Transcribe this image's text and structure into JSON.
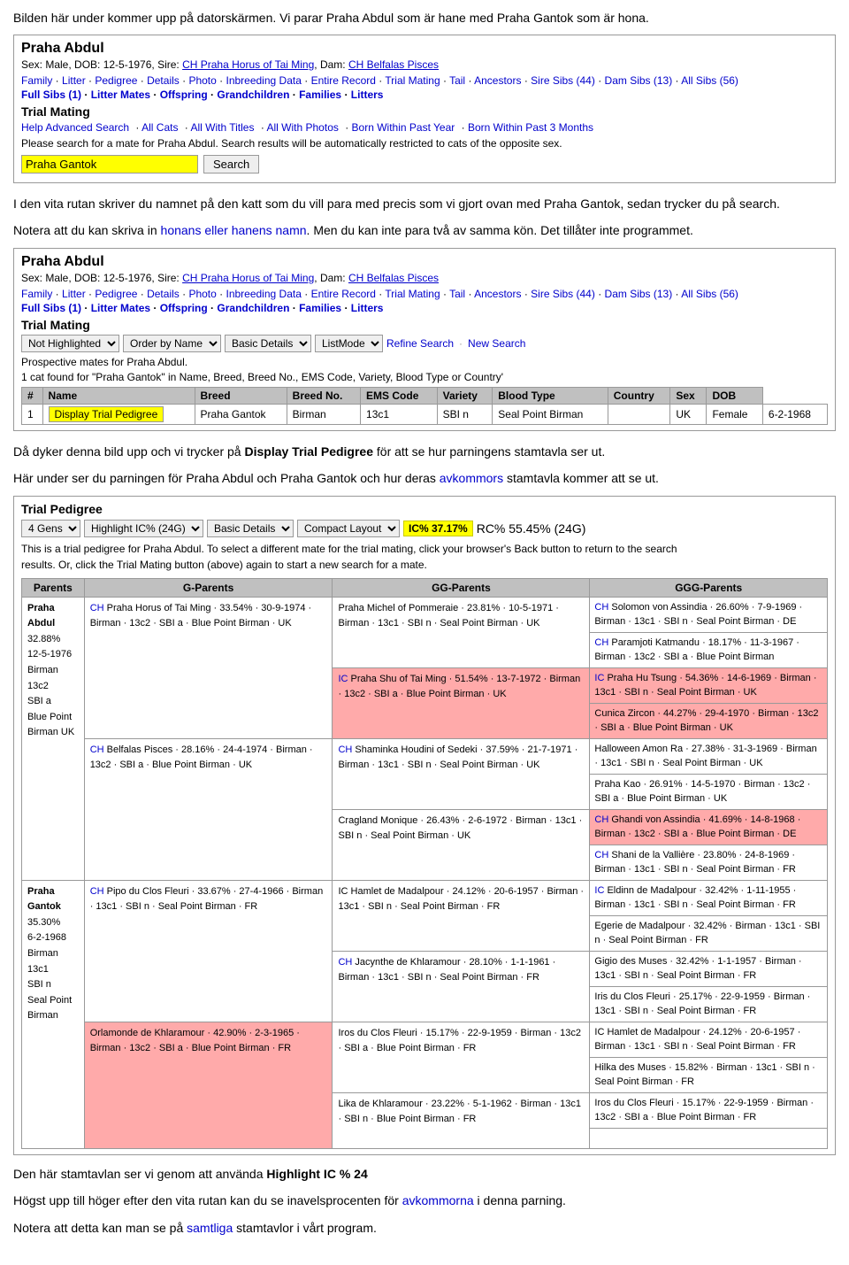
{
  "intro": {
    "heading": "Bilden här under kommer upp på datorskärmen. Vi parar Praha Abdul som är hane med Praha Gantok som är hona.",
    "cat_name": "Praha Abdul",
    "cat_info": "Sex: Male, DOB: 12-5-1976, Sire: CH Praha Horus of Tai Ming, Dam: CH Belfalas Pisces",
    "nav1": "Family · Litter · Pedigree · Details · Photo · Inbreeding Data · Entire Record · Trial Mating · Tail · Ancestors · Sire Sibs (44) · Dam Sibs (13) · All Sibs (56)",
    "nav2": "Full Sibs (1) · Litter Mates · Offspring · Grandchildren · Families · Litters",
    "section_title": "Trial Mating",
    "trial_links": "Help Advanced Search · All Cats · All With Titles · All With Photos · Born Within Past Year · Born Within Past 3 Months",
    "search_note": "Please search for a mate for Praha Abdul. Search results will be automatically restricted to cats of the opposite sex.",
    "search_placeholder": "Praha Gantok",
    "search_btn": "Search"
  },
  "body1": {
    "para1": "I den vita rutan skriver du namnet på den katt som du vill para med precis som vi gjort ovan med Praha Gantok, sedan trycker du på search.",
    "para2_prefix": "Notera att du kan skriva in ",
    "para2_link": "honans eller hanens namn",
    "para2_suffix": ". Men du kan inte para två av samma kön. Det tillåter inte programmet."
  },
  "pedigree2": {
    "cat_name": "Praha Abdul",
    "cat_info": "Sex: Male, DOB: 12-5-1976, Sire: CH Praha Horus of Tai Ming, Dam: CH Belfalas Pisces",
    "nav1": "Family · Litter · Pedigree · Details · Photo · Inbreeding Data · Entire Record · Trial Mating · Tail · Ancestors · Sire Sibs (44) · Dam Sibs (13) · All Sibs (56)",
    "nav2": "Full Sibs (1) · Litter Mates · Offspring · Grandchildren · Families · Litters",
    "section_title": "Trial Mating",
    "not_highlighted_label": "Not Highlighted",
    "order_label": "Order by Name",
    "basic_details_label": "Basic Details",
    "list_mode_label": "ListMode",
    "refine_search": "Refine Search",
    "new_search": "New Search",
    "prospect_text": "Prospective mates for Praha Abdul.",
    "found_text": "1 cat found for \"Praha Gantok\" in Name, Breed, Breed No., EMS Code, Variety, Blood Type or Country'",
    "table_headers": [
      "#",
      "Name",
      "Breed",
      "Breed No.",
      "EMS Code",
      "Variety",
      "Blood Type",
      "Country",
      "Sex",
      "DOB"
    ],
    "table_row": {
      "num": "1",
      "btn": "Display Trial Pedigree",
      "name": "Praha Gantok",
      "breed": "Birman",
      "breed_no": "13c1",
      "ems_code": "SBI n",
      "variety": "Seal Point Birman",
      "blood_type": "",
      "country": "UK",
      "sex": "Female",
      "dob": "6-2-1968"
    }
  },
  "body2": {
    "para1_prefix": "Då dyker denna bild upp och vi trycker på ",
    "para1_bold": "Display Trial Pedigree",
    "para1_suffix": " för att se hur parningens stamtavla ser ut.",
    "para2_prefix": "Här under ser du parningen för Praha Abdul och Praha Gantok och hur deras ",
    "para2_link": "avkommors",
    "para2_suffix": " stamtavla kommer att se ut."
  },
  "trial_pedigree": {
    "title": "Trial Pedigree",
    "genes_label": "4 Gens",
    "highlight_label": "Highlight IC% (24G)",
    "basic_details_label": "Basic Details",
    "compact_layout_label": "Compact Layout",
    "ic_badge": "IC% 37.17%",
    "rc_text": "RC% 55.45% (24G)",
    "note_line1": "This is a trial pedigree for Praha Abdul. To select a different mate for the trial mating, click your browser's Back button to return to the search",
    "note_line2": "results. Or, click the Trial Mating button (above) again to start a new search for a mate.",
    "col_parents": "Parents",
    "col_gparents": "G-Parents",
    "col_ggparents": "GG-Parents",
    "col_gggparents": "GGG-Parents",
    "parents": [
      {
        "name": "Praha Abdul",
        "pct": "32.88%",
        "dob": "12-5-1976",
        "breed": "Birman",
        "breed_no": "13c2",
        "ems": "SBI a",
        "variety": "Blue Point",
        "country": "Birman UK"
      },
      {
        "name": "Praha Gantok",
        "pct": "35.30%",
        "dob": "6-2-1968",
        "breed": "Birman",
        "breed_no": "13c1",
        "ems": "SBI n",
        "variety": "Seal Point",
        "country": "Birman"
      }
    ],
    "g_parents": [
      {
        "ch": "CH",
        "name": "Praha Horus of Tai Ming",
        "pct": "33.54%",
        "dates": "30-9-1974",
        "info": "Birman · 13c2 · SBI a · Blue Point Birman · UK"
      },
      {
        "ch": "CH",
        "name": "Belfalas Pisces",
        "pct": "28.16%",
        "dates": "24-4-1974",
        "info": "Birman · 13c2 · SBI a · Blue Point Birman · UK"
      },
      {
        "ch": "",
        "name": "Pipo du Clos Fleuri",
        "pct": "33.67%",
        "dates": "27-4-1966",
        "info": "Birman · 13c1 · SBI n · Seal Point Birman · FR"
      },
      {
        "ch": "",
        "name": "Orlamonde de Khlaramour",
        "pct": "42.90%",
        "dates": "2-3-1965",
        "info": "Birman · 13c2 · SBI a · Blue Point Birman · FR",
        "highlight": true
      }
    ],
    "gg_parents": [
      {
        "name": "Praha Michel of Pommeraie",
        "pct": "23.81%",
        "dates": "10-5-1971",
        "info": "Birman · 13c1 · SBI n · Seal Point Birman · UK"
      },
      {
        "name": "Praha Shu of Tai Ming",
        "pct": "51.54%",
        "dates": "13-7-1972",
        "info": "Birman · 13c2 · SBI a · Blue Point Birman · UK",
        "highlight": true
      },
      {
        "name": "CH Shaminka Houdini of Sedeki",
        "pct": "37.59%",
        "dates": "21-7-1971",
        "info": "Birman · 13c1 · SBI n · Seal Point Birman · UK"
      },
      {
        "name": "Cragland Monique",
        "pct": "26.43%",
        "dates": "2-6-1972",
        "info": "Birman · 13c1 · SBI n · Seal Point Birman · UK"
      },
      {
        "name": "IC Hamlet de Madalpour",
        "pct": "24.12%",
        "dates": "20-6-1957",
        "info": "Birman · 13c1 · SBI n · Seal Point Birman · FR"
      },
      {
        "name": "CH Jacynthe de Khlaramour",
        "pct": "28.10%",
        "dates": "1-1-1961",
        "info": "Birman · 13c1 · SBI n · Seal Point Birman · FR"
      },
      {
        "name": "Iros du Clos Fleuri",
        "pct": "15.17%",
        "dates": "22-9-1959",
        "info": "Birman · 13c2 · SBI a · Blue Point Birman · FR"
      },
      {
        "name": "Lika de Khlaramour",
        "pct": "23.22%",
        "dates": "5-1-1962",
        "info": "Birman · 13c1 · SBI n · Blue Point Birman · FR"
      }
    ],
    "ggg_parents": [
      {
        "name": "CH Solomon von Assindia",
        "pct": "26.60%",
        "dates": "7-9-1969",
        "info": "Birman · 13c1 · SBI n · Seal Point Birman · DE"
      },
      {
        "name": "CH Paramjoti Katmandu",
        "pct": "18.17%",
        "dates": "11-3-1967",
        "info": "Birman · 13c2 · SBI a · Blue Point Birman"
      },
      {
        "name": "IC Praha Hu Tsung",
        "pct": "54.36%",
        "dates": "14-6-1969",
        "info": "Birman · 13c1 · SBI n · Seal Point Birman · UK",
        "highlight": true
      },
      {
        "name": "Cunica Zircon",
        "pct": "44.27%",
        "dates": "29-4-1970",
        "info": "Birman · 13c2 · SBI a · Blue Point Birman · UK",
        "highlight": true
      },
      {
        "name": "Halloween Amon Ra",
        "pct": "27.38%",
        "dates": "31-3-1969",
        "info": "Birman · 13c1 · SBI n · Seal Point Birman · UK"
      },
      {
        "name": "Praha Kao",
        "pct": "26.91%",
        "dates": "14-5-1970",
        "info": "Birman · 13c2 · SBI a · Blue Point Birman · UK"
      },
      {
        "name": "CH Ghandi von Assindia",
        "pct": "41.69%",
        "dates": "14-8-1968",
        "info": "Birman · 13c2 · SBI a · Blue Point Birman · DE",
        "highlight": true
      },
      {
        "name": "CH Shani de la Vallière",
        "pct": "23.80%",
        "dates": "24-8-1969",
        "info": "Birman · 13c1 · SBI n · Seal Point Birman · FR"
      },
      {
        "name": "IC Eldinn de Madalpour",
        "pct": "32.42%",
        "dates": "1-11-1955",
        "info": "Birman · 13c1 · SBI n · Seal Point Birman · FR"
      },
      {
        "name": "Egerie de Madalpour",
        "pct": "32.42%",
        "dates": "",
        "info": "Birman · 13c1 · SBI n · Seal Point Birman · FR"
      },
      {
        "name": "Gigio des Muses",
        "pct": "32.42%",
        "dates": "1-1-1957",
        "info": "Birman · 13c1 · SBI n · Seal Point Birman · FR"
      },
      {
        "name": "Iris du Clos Fleuri",
        "pct": "25.17%",
        "dates": "22-9-1959",
        "info": "Birman · 13c1 · SBI n · Seal Point Birman · FR"
      },
      {
        "name": "IC Hamlet de Madalpour",
        "pct": "24.12%",
        "dates": "20-6-1957",
        "info": "Birman · 13c1 · SBI n · Seal Point Birman · FR"
      },
      {
        "name": "Hilka des Muses",
        "pct": "15.82%",
        "dates": "",
        "info": "Birman · 13c1 · SBI n · Seal Point Birman · FR"
      },
      {
        "name": "Iros du Clos Fleuri",
        "pct": "15.17%",
        "dates": "22-9-1959",
        "info": "Birman · 13c2 · SBI a · Blue Point Birman · FR"
      }
    ]
  },
  "body3": {
    "para1_prefix": "Den här stamtavlan ser vi genom att använda ",
    "para1_bold": "Highlight IC % 24",
    "para2_prefix": "Högst upp till höger efter den vita rutan kan du se inavelsprocenten för ",
    "para2_link": "avkommorna",
    "para2_suffix": " i denna parning.",
    "para3_prefix": "Notera att detta kan man se på ",
    "para3_link": "samtliga",
    "para3_suffix": " stamtavlor i vårt program."
  }
}
